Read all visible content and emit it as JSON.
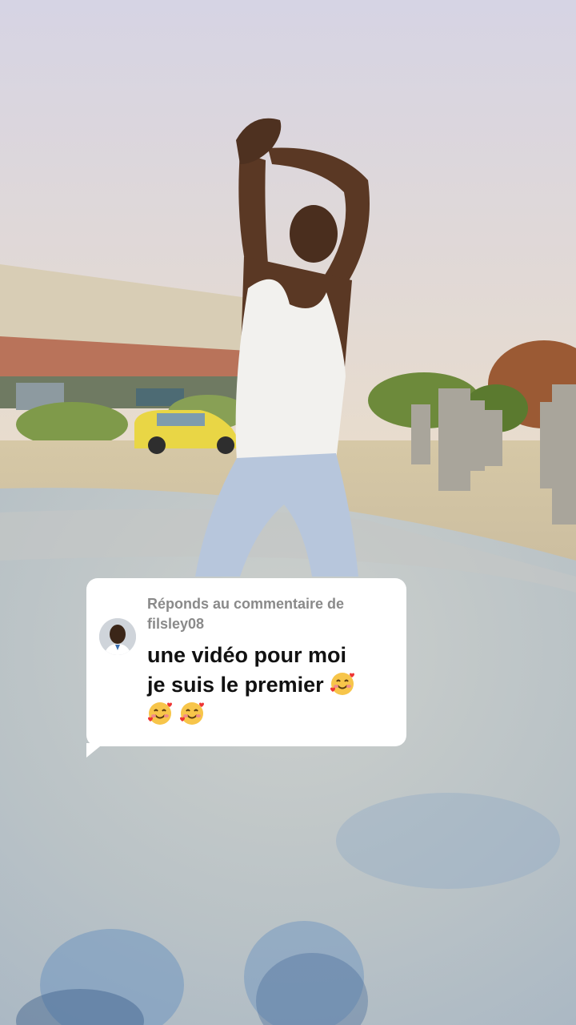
{
  "reply": {
    "header_prefix": "Réponds au commentaire de",
    "username": "filsley08",
    "comment_line1": "une vidéo pour moi",
    "comment_line2_text": "je suis le premier",
    "emoji_name": "smiling-face-with-hearts-icon",
    "emoji_count": 3
  },
  "colors": {
    "card_bg": "#ffffff",
    "header_text": "#8a8a8a",
    "comment_text": "#111111",
    "sky": "#d9d6e4",
    "ground": "#cfc3a4"
  }
}
